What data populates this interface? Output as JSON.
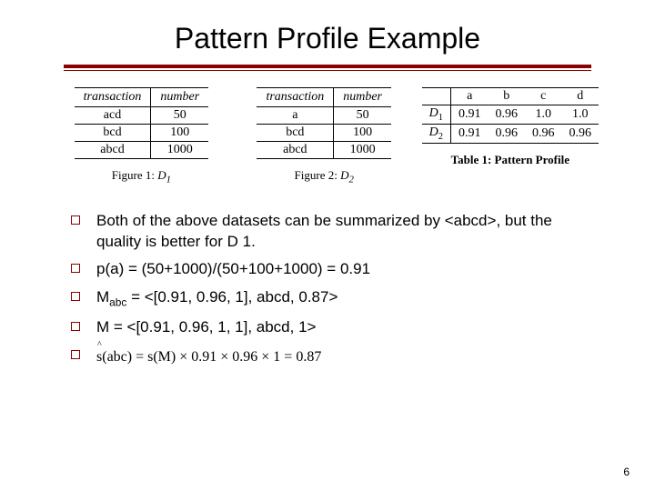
{
  "title": "Pattern Profile Example",
  "figures": {
    "fig1": {
      "headers": [
        "transaction",
        "number"
      ],
      "rows": [
        {
          "t": "acd",
          "n": "50"
        },
        {
          "t": "bcd",
          "n": "100"
        },
        {
          "t": "abcd",
          "n": "1000"
        }
      ],
      "caption_prefix": "Figure 1: ",
      "caption_math": "D",
      "caption_sub": "1"
    },
    "fig2": {
      "headers": [
        "transaction",
        "number"
      ],
      "rows": [
        {
          "t": "a",
          "n": "50"
        },
        {
          "t": "bcd",
          "n": "100"
        },
        {
          "t": "abcd",
          "n": "1000"
        }
      ],
      "caption_prefix": "Figure 2: ",
      "caption_math": "D",
      "caption_sub": "2"
    },
    "table1": {
      "headers": [
        "",
        "a",
        "b",
        "c",
        "d"
      ],
      "rows": [
        {
          "h": "D",
          "hsub": "1",
          "v": [
            "0.91",
            "0.96",
            "1.0",
            "1.0"
          ]
        },
        {
          "h": "D",
          "hsub": "2",
          "v": [
            "0.91",
            "0.96",
            "0.96",
            "0.96"
          ]
        }
      ],
      "caption": "Table 1: Pattern Profile"
    }
  },
  "bullets": {
    "b1": "Both of the above datasets can be summarized by <abcd>, but the quality is better for D 1.",
    "b2": "p(a) = (50+1000)/(50+100+1000) = 0.91",
    "b3_pre": "M",
    "b3_sub": "abc",
    "b3_post": " = <[0.91, 0.96, 1], abcd, 0.87>",
    "b4": "M = <[0.91, 0.96, 1, 1], abcd, 1>",
    "b5": "s(abc) = s(M) × 0.91 × 0.96 × 1 = 0.87"
  },
  "pagenum": "6"
}
